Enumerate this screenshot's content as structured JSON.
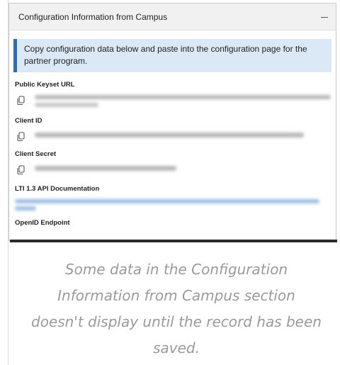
{
  "panel": {
    "title": "Configuration Information from Campus",
    "collapse_icon": "minus-icon"
  },
  "info": {
    "text": "Copy configuration data below and paste into the configuration page for the partner program."
  },
  "fields": [
    {
      "label": "Public Keyset URL",
      "icon": "copy-icon"
    },
    {
      "label": "Client ID",
      "icon": "copy-icon"
    },
    {
      "label": "Client Secret",
      "icon": "copy-icon"
    },
    {
      "label": "LTI 1.3 API Documentation"
    },
    {
      "label": "OpenID Endpoint"
    }
  ],
  "caption": "Some data in the Configuration Information from Campus section doesn't display until the record has been saved.",
  "colors": {
    "info_bg": "#dbe8f6",
    "info_border": "#2a6fb3",
    "link_blur": "#9cbde3"
  }
}
